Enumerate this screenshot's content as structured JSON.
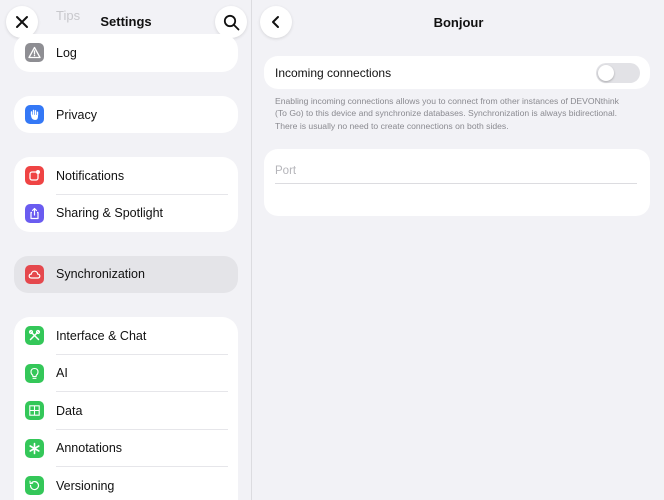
{
  "sidebar": {
    "title": "Settings",
    "ghost_item": "Tips",
    "groups": [
      [
        {
          "label": "Log",
          "icon": "warning-triangle-icon",
          "color": "#8e8e93"
        }
      ],
      [
        {
          "label": "Privacy",
          "icon": "hand-icon",
          "color": "#3478f6"
        }
      ],
      [
        {
          "label": "Notifications",
          "icon": "notification-badge-icon",
          "color": "#ef4444"
        },
        {
          "label": "Sharing & Spotlight",
          "icon": "share-icon",
          "color": "#6a5cf0"
        }
      ],
      [
        {
          "label": "Synchronization",
          "icon": "cloud-icon",
          "color": "#e5484d",
          "selected": true
        }
      ],
      [
        {
          "label": "Interface & Chat",
          "icon": "tools-icon",
          "color": "#34c759"
        },
        {
          "label": "AI",
          "icon": "lightbulb-icon",
          "color": "#34c759"
        },
        {
          "label": "Data",
          "icon": "grid-icon",
          "color": "#34c759"
        },
        {
          "label": "Annotations",
          "icon": "asterisk-icon",
          "color": "#34c759"
        },
        {
          "label": "Versioning",
          "icon": "history-icon",
          "color": "#34c759"
        }
      ]
    ]
  },
  "main": {
    "title": "Bonjour",
    "incoming": {
      "label": "Incoming connections",
      "enabled": false
    },
    "help_text": "Enabling incoming connections allows you to connect from other instances of DEVONthink (To Go) to this device and synchronize databases. Synchronization is always bidirectional. There is usually no need to create connections on both sides.",
    "port": {
      "placeholder": "Port",
      "value": ""
    }
  }
}
